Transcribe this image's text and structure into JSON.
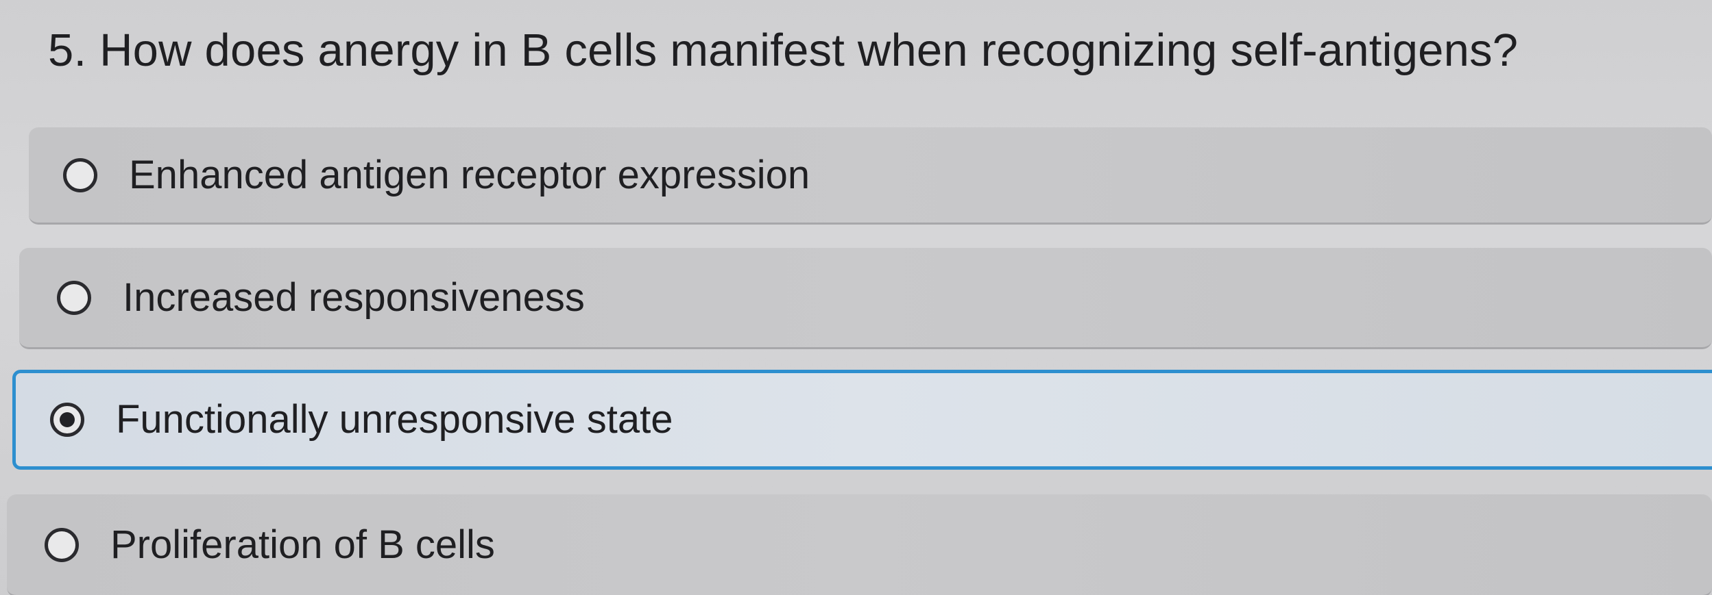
{
  "question": {
    "text": "5. How does anergy in B cells manifest when recognizing self-antigens?"
  },
  "options": [
    {
      "label": "Enhanced antigen receptor expression",
      "selected": false
    },
    {
      "label": "Increased responsiveness",
      "selected": false
    },
    {
      "label": "Functionally unresponsive state",
      "selected": true
    },
    {
      "label": "Proliferation of B cells",
      "selected": false
    }
  ],
  "colors": {
    "selected_border": "#2d8fcf",
    "selected_background": "#dde3ea",
    "unselected_background": "#c7c7c9",
    "page_background": "#d3d3d5"
  }
}
